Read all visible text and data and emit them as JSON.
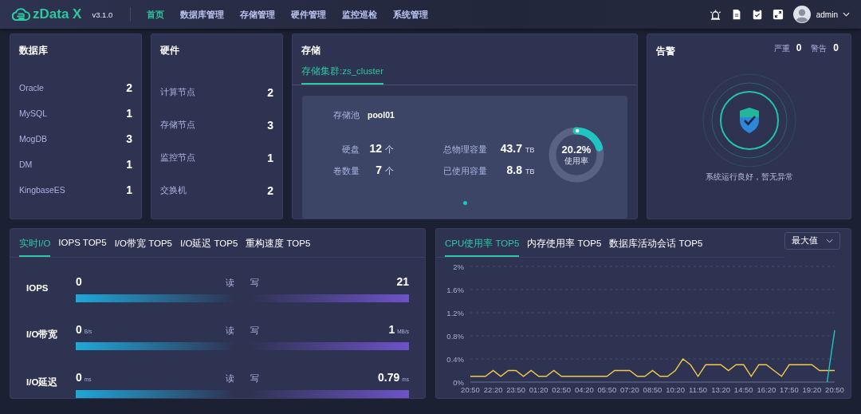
{
  "header": {
    "logo": "zData X",
    "version": "v3.1.0",
    "nav": [
      {
        "label": "首页",
        "selected": true
      },
      {
        "label": "数据库管理",
        "selected": false
      },
      {
        "label": "存储管理",
        "selected": false
      },
      {
        "label": "硬件管理",
        "selected": false
      },
      {
        "label": "监控巡检",
        "selected": false
      },
      {
        "label": "系统管理",
        "selected": false
      }
    ],
    "user": "admin"
  },
  "database_card": {
    "title": "数据库",
    "items": [
      {
        "name": "Oracle",
        "count": "2"
      },
      {
        "name": "MySQL",
        "count": "1"
      },
      {
        "name": "MogDB",
        "count": "3"
      },
      {
        "name": "DM",
        "count": "1"
      },
      {
        "name": "KingbaseES",
        "count": "1"
      }
    ]
  },
  "hardware_card": {
    "title": "硬件",
    "items": [
      {
        "name": "计算节点",
        "count": "2"
      },
      {
        "name": "存储节点",
        "count": "3"
      },
      {
        "name": "监控节点",
        "count": "1"
      },
      {
        "name": "交换机",
        "count": "2"
      }
    ]
  },
  "storage_card": {
    "title": "存储",
    "tabs": [
      {
        "label": "存储集群:zs_cluster",
        "selected": true
      }
    ],
    "pool_label": "存储池",
    "pool": "pool01",
    "stats": [
      {
        "label": "硬盘",
        "value": "12",
        "unit": "个"
      },
      {
        "label": "卷数量",
        "value": "7",
        "unit": "个"
      }
    ],
    "capacity": [
      {
        "label": "总物理容量",
        "value": "43.7",
        "unit": "TB"
      },
      {
        "label": "已使用容量",
        "value": "8.8",
        "unit": "TB"
      }
    ],
    "usage": {
      "percent": "20.2%",
      "label": "使用率",
      "level": 0.202
    },
    "pages": [
      {
        "selected": true
      }
    ]
  },
  "alert_card": {
    "title": "告警",
    "counts": [
      {
        "label": "严重",
        "value": "0"
      },
      {
        "label": "警告",
        "value": "0"
      }
    ],
    "message": "系统运行良好，暂无异常"
  },
  "io_card": {
    "tabs": [
      {
        "label": "实时I/O",
        "selected": true
      },
      {
        "label": "IOPS TOP5",
        "selected": false
      },
      {
        "label": "I/O带宽 TOP5",
        "selected": false
      },
      {
        "label": "I/O延迟 TOP5",
        "selected": false
      },
      {
        "label": "重构速度 TOP5",
        "selected": false
      }
    ],
    "rows": [
      {
        "name": "IOPS",
        "read_value": "0",
        "read_label": "读",
        "write_label": "写",
        "write_value": "21"
      },
      {
        "name": "I/O带宽",
        "read_value": "0",
        "read_unit": "B/s",
        "read_label": "读",
        "write_label": "写",
        "write_value": "1",
        "write_unit": "MB/s"
      },
      {
        "name": "I/O延迟",
        "read_value": "0",
        "read_unit": "ms",
        "read_label": "读",
        "write_label": "写",
        "write_value": "0.79",
        "write_unit": "ms"
      }
    ]
  },
  "chart_card": {
    "tabs": [
      {
        "label": "CPU使用率 TOP5",
        "selected": true
      },
      {
        "label": "内存使用率 TOP5",
        "selected": false
      },
      {
        "label": "数据库活动会话 TOP5",
        "selected": false
      }
    ],
    "select": {
      "value": "最大值"
    },
    "chart_data": {
      "type": "line",
      "categories": [
        "20:50",
        null,
        null,
        "22:20",
        null,
        null,
        "23:50",
        null,
        null,
        "01:20",
        null,
        null,
        "02:50",
        null,
        null,
        "04:20",
        null,
        null,
        "05:50",
        null,
        null,
        "07:20",
        null,
        null,
        "08:50",
        null,
        null,
        "10:20",
        null,
        null,
        "11:50",
        null,
        null,
        "13:20",
        null,
        null,
        "14:50",
        null,
        null,
        "16:20",
        null,
        null,
        "17:50",
        null,
        null,
        "19:20",
        null,
        null,
        "20:50"
      ],
      "series": [
        {
          "color": "#f2c94c",
          "values": [
            0.1,
            0.1,
            0.1,
            0.2,
            0.1,
            0.2,
            0.2,
            0.1,
            0.2,
            0.1,
            0.1,
            0.2,
            0.1,
            0.1,
            0.1,
            0.1,
            0.1,
            0.1,
            0.1,
            0.2,
            0.2,
            0.2,
            0.1,
            0.1,
            0.2,
            0.1,
            0.1,
            0.2,
            0.4,
            0.3,
            0.1,
            0.3,
            0.3,
            0.3,
            0.2,
            0.3,
            0.3,
            0.1,
            0.3,
            0.3,
            0.2,
            0.1,
            0.3,
            0.3,
            0.3,
            0.3,
            0.2,
            0.2,
            0.2
          ]
        },
        {
          "color": "#1fc6c1",
          "values": [
            null,
            null,
            null,
            null,
            null,
            null,
            null,
            null,
            null,
            null,
            null,
            null,
            null,
            null,
            null,
            null,
            null,
            null,
            null,
            null,
            null,
            null,
            null,
            null,
            null,
            null,
            null,
            null,
            null,
            null,
            null,
            null,
            null,
            null,
            null,
            null,
            null,
            null,
            null,
            null,
            null,
            null,
            null,
            null,
            null,
            null,
            null,
            0,
            0.9
          ]
        }
      ],
      "ylim": [
        0,
        2
      ],
      "grid": true,
      "yticks": [
        {
          "value": 0,
          "label": "0%"
        },
        {
          "value": 0.4,
          "label": "0.4%"
        },
        {
          "value": 0.8,
          "label": "0.8%"
        },
        {
          "value": 1.2,
          "label": "1.2%"
        },
        {
          "value": 1.6,
          "label": "1.6%"
        },
        {
          "value": 2,
          "label": "2%"
        }
      ]
    }
  }
}
